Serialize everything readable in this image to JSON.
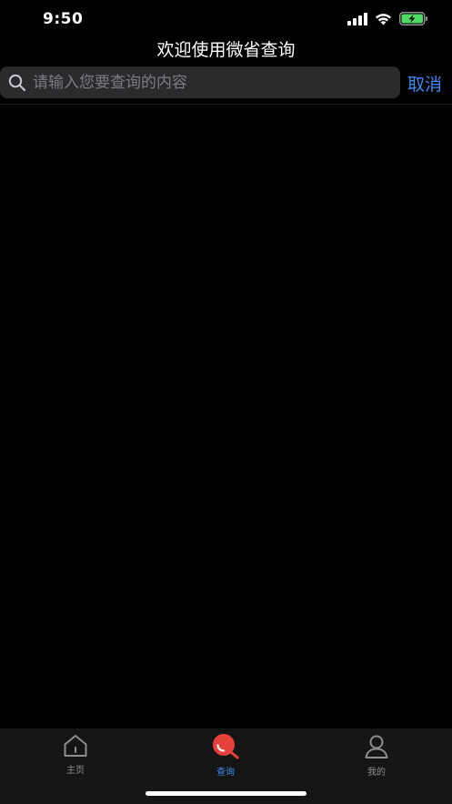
{
  "status_bar": {
    "time": "9:50",
    "signal_icon": "cellular-signal-icon",
    "wifi_icon": "wifi-icon",
    "battery_icon": "battery-charging-icon",
    "battery_color": "#4cd964"
  },
  "nav": {
    "title": "欢迎使用微省查询"
  },
  "search": {
    "placeholder": "请输入您要查询的内容",
    "value": "",
    "icon": "search-icon",
    "cancel_label": "取消"
  },
  "tab_bar": {
    "items": [
      {
        "label": "主页",
        "icon": "home-icon",
        "active": false
      },
      {
        "label": "查询",
        "icon": "query-icon",
        "active": true
      },
      {
        "label": "我的",
        "icon": "profile-icon",
        "active": false
      }
    ]
  },
  "colors": {
    "background": "#000000",
    "accent": "#3d8bf5",
    "tab_bar_bg": "#151515",
    "search_bg": "#2b2b2e",
    "query_icon_red": "#e8413c"
  }
}
